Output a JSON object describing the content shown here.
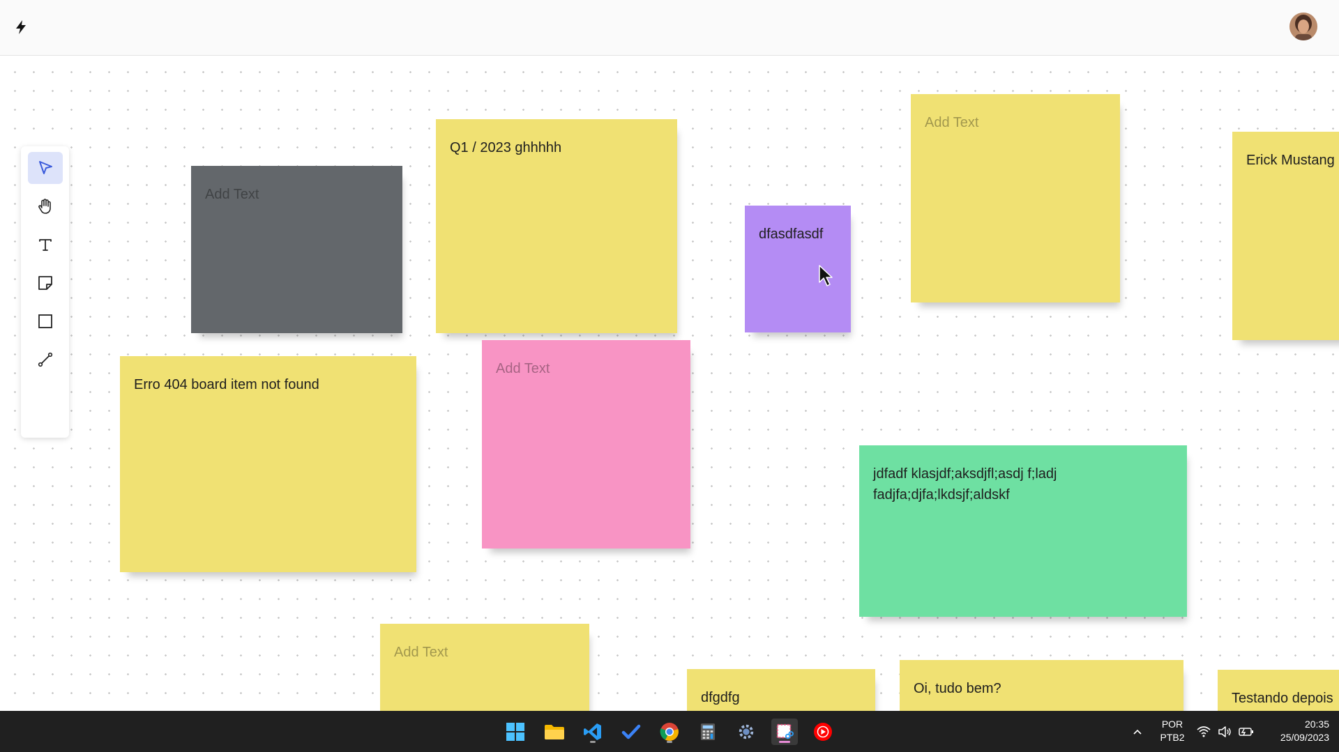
{
  "header": {
    "logo_icon": "bolt-icon",
    "avatar_icon": "user-avatar"
  },
  "toolbar": {
    "tools": [
      {
        "name": "select",
        "icon": "cursor-arrow-icon",
        "active": true
      },
      {
        "name": "pan",
        "icon": "hand-icon",
        "active": false
      },
      {
        "name": "text",
        "icon": "text-icon",
        "active": false
      },
      {
        "name": "sticky-note",
        "icon": "sticky-note-icon",
        "active": false
      },
      {
        "name": "rectangle",
        "icon": "square-icon",
        "active": false
      },
      {
        "name": "connector",
        "icon": "line-icon",
        "active": false
      }
    ]
  },
  "board": {
    "notes": [
      {
        "id": "note-gray",
        "text": "Add Text",
        "placeholder": true,
        "color": "#63676b"
      },
      {
        "id": "note-q1",
        "text": "Q1 / 2023 ghhhhh",
        "placeholder": false,
        "color": "#f0e173"
      },
      {
        "id": "note-purple",
        "text": "dfasdfasdf",
        "placeholder": false,
        "color": "#b48cf4"
      },
      {
        "id": "note-yellow-top",
        "text": "Add Text",
        "placeholder": true,
        "color": "#f0e173"
      },
      {
        "id": "note-erick",
        "text": "Erick Mustang",
        "placeholder": false,
        "color": "#f0e173"
      },
      {
        "id": "note-erro",
        "text": "Erro 404 board item not found",
        "placeholder": false,
        "color": "#f0e173"
      },
      {
        "id": "note-pink",
        "text": "Add Text",
        "placeholder": true,
        "color": "#f894c4"
      },
      {
        "id": "note-green",
        "text": "jdfadf klasjdf;aksdjfl;asdj f;ladj fadjfa;djfa;lkdsjf;aldskf",
        "placeholder": false,
        "color": "#6ee0a2"
      },
      {
        "id": "note-bottom-1",
        "text": "Add Text",
        "placeholder": true,
        "color": "#f0e173"
      },
      {
        "id": "note-dfgdfg",
        "text": "dfgdfg",
        "placeholder": false,
        "color": "#f0e173"
      },
      {
        "id": "note-oi",
        "text": "Oi, tudo bem?",
        "placeholder": false,
        "color": "#f0e173"
      },
      {
        "id": "note-testando",
        "text": "Testando depois",
        "placeholder": false,
        "color": "#f0e173"
      }
    ]
  },
  "taskbar": {
    "apps": [
      {
        "name": "start",
        "icon": "windows-icon"
      },
      {
        "name": "file-explorer",
        "icon": "folder-icon"
      },
      {
        "name": "vscode",
        "icon": "vscode-icon"
      },
      {
        "name": "todo",
        "icon": "checkmark-icon"
      },
      {
        "name": "chrome",
        "icon": "chrome-icon"
      },
      {
        "name": "calculator",
        "icon": "calculator-icon"
      },
      {
        "name": "app-gear",
        "icon": "gear-icon"
      },
      {
        "name": "snipping-tool",
        "icon": "snip-icon"
      },
      {
        "name": "youtube-music",
        "icon": "play-icon"
      }
    ],
    "tray": {
      "language": "POR",
      "keyboard": "PTB2",
      "time": "20:35",
      "date": "25/09/2023"
    }
  }
}
